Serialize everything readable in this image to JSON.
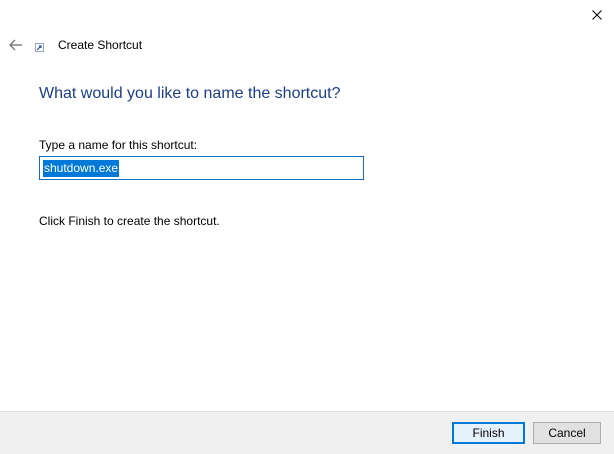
{
  "window": {
    "title": "Create Shortcut"
  },
  "icons": {
    "close": "close-icon",
    "back": "back-arrow-icon",
    "shortcut": "shortcut-icon"
  },
  "page": {
    "heading": "What would you like to name the shortcut?",
    "field_label": "Type a name for this shortcut:",
    "name_value": "shutdown.exe",
    "instruction": "Click Finish to create the shortcut."
  },
  "footer": {
    "finish_label": "Finish",
    "cancel_label": "Cancel"
  },
  "colors": {
    "heading": "#1c3c8c",
    "selection": "#0078d7",
    "footer_bg": "#f0f0f0"
  }
}
